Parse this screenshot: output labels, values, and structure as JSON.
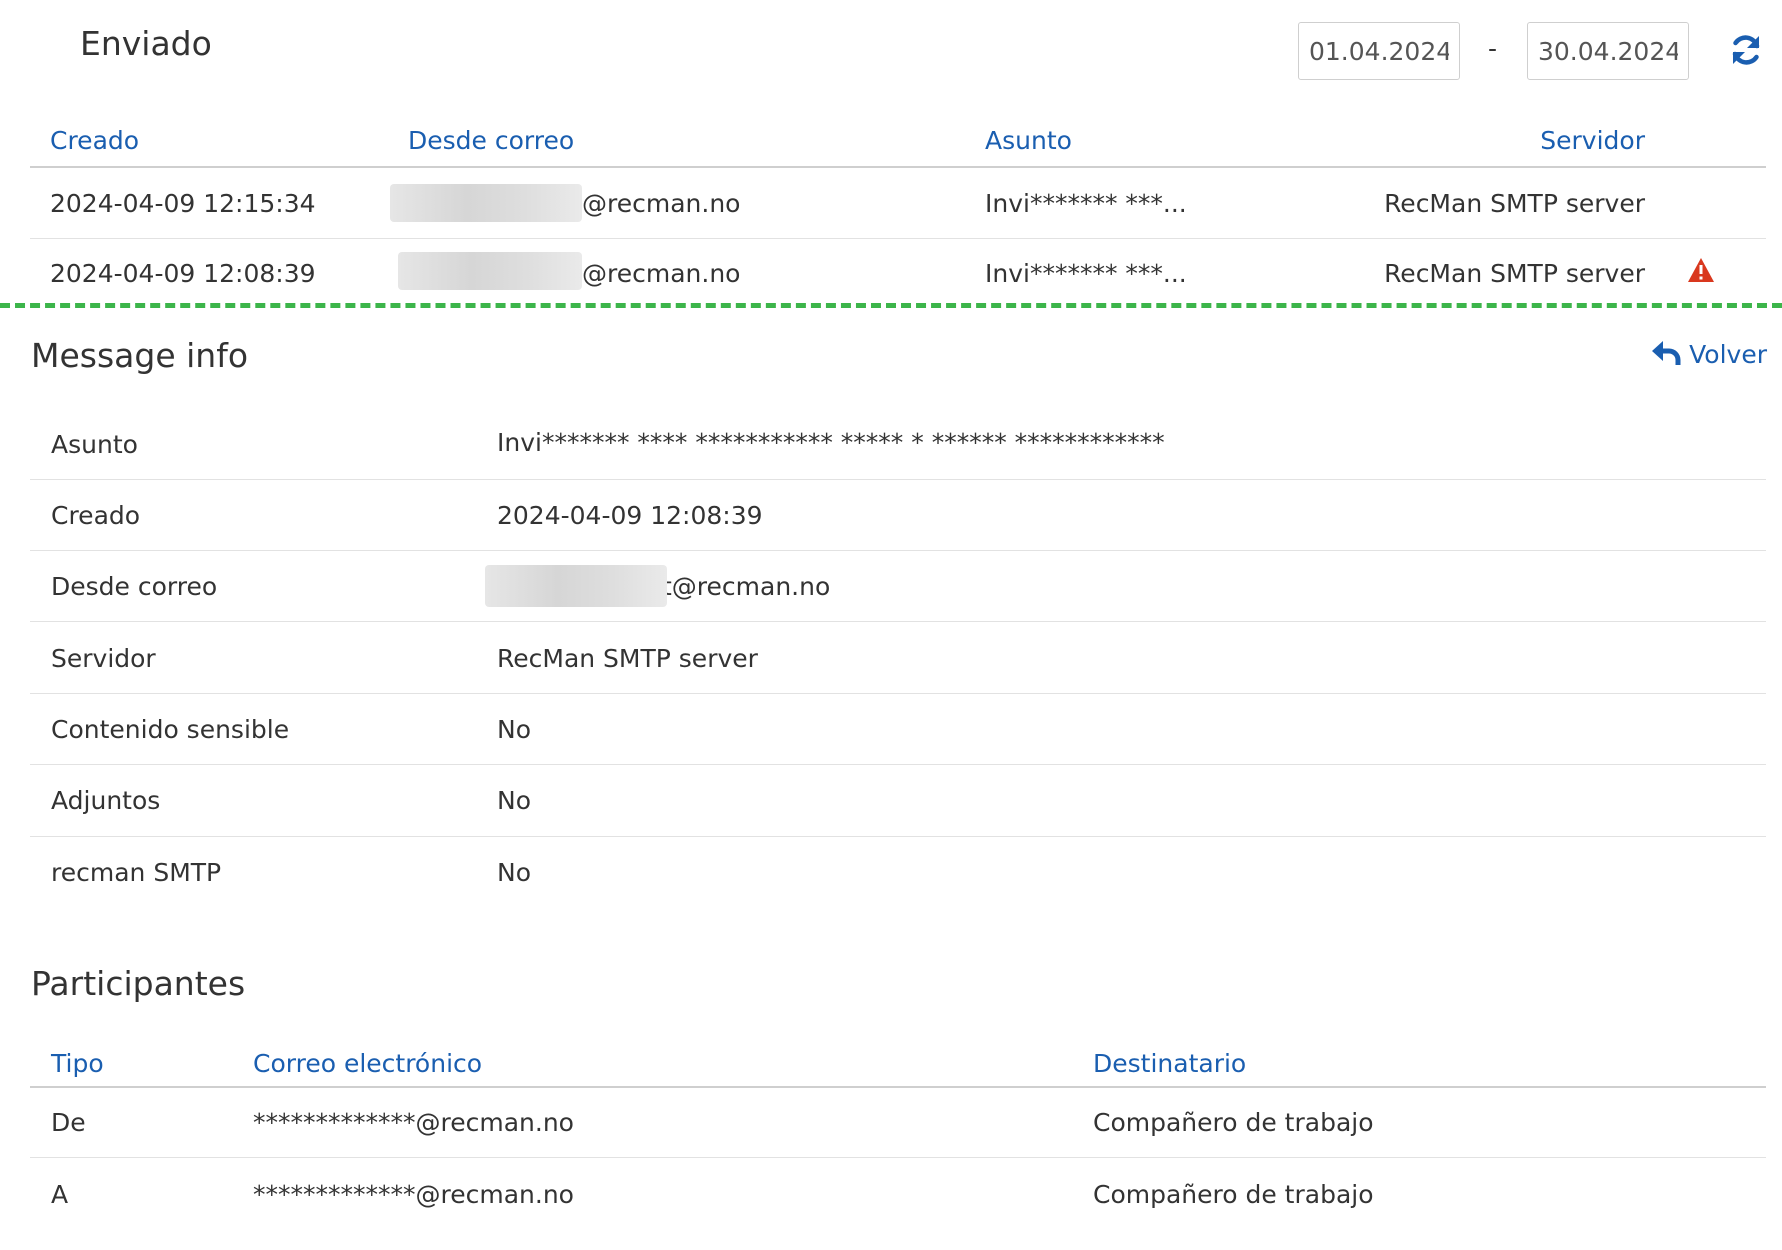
{
  "sent_header": {
    "title": "Enviado",
    "date_from": "01.04.2024",
    "date_separator": "-",
    "date_to": "30.04.2024",
    "refresh_icon": "refresh-icon"
  },
  "sent_table": {
    "columns": [
      "Creado",
      "Desde correo",
      "Asunto",
      "Servidor"
    ],
    "rows": [
      {
        "created": "2024-04-09 12:15:34",
        "from": "@recman.no",
        "subject": "Invi******* ***...",
        "server": "RecMan SMTP server",
        "warning": false
      },
      {
        "created": "2024-04-09 12:08:39",
        "from": "@recman.no",
        "subject": "Invi******* ***...",
        "server": "RecMan SMTP server",
        "warning": true
      }
    ]
  },
  "message_info": {
    "title": "Message info",
    "back_label": "Volver",
    "rows": [
      {
        "label": "Asunto",
        "value": "Invi******* **** *********** ***** * ****** ************"
      },
      {
        "label": "Creado",
        "value": "2024-04-09 12:08:39"
      },
      {
        "label": "Desde correo",
        "value": "t@recman.no"
      },
      {
        "label": "Servidor",
        "value": "RecMan SMTP server"
      },
      {
        "label": "Contenido sensible",
        "value": "No"
      },
      {
        "label": "Adjuntos",
        "value": "No"
      },
      {
        "label": "recman SMTP",
        "value": "No"
      }
    ]
  },
  "participants": {
    "title": "Participantes",
    "columns": [
      "Tipo",
      "Correo electrónico",
      "Destinatario"
    ],
    "rows": [
      {
        "type": "De",
        "email": "*************@recman.no",
        "recipient": "Compañero de trabajo"
      },
      {
        "type": "A",
        "email": "*************@recman.no",
        "recipient": "Compañero de trabajo"
      }
    ]
  },
  "colors": {
    "link": "#1a5eb0",
    "warning": "#d9381e",
    "dashed_divider": "#3cb54a"
  }
}
